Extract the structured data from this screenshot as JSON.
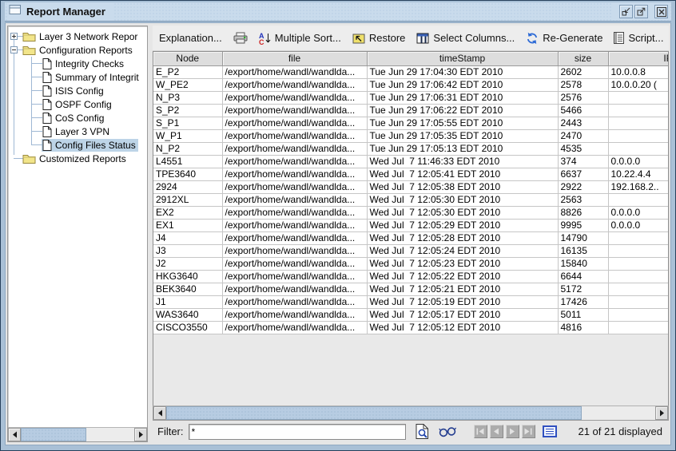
{
  "window": {
    "title": "Report Manager",
    "controls": [
      {
        "name": "minimize-button",
        "icon": "minimize"
      },
      {
        "name": "maximize-button",
        "icon": "maximize"
      },
      {
        "name": "close-button",
        "icon": "close"
      }
    ]
  },
  "colors": {
    "titlebar": "#C9DBEC",
    "frame": "#A9C0D6",
    "tree_selection": "#BDD4E7",
    "scroll_thumb": "#B7CCE2",
    "header_bg": "#DDDDDD"
  },
  "tree": {
    "items": [
      {
        "name": "tree-item-layer3-network-reports",
        "label": "Layer 3 Network Repor",
        "type": "folder",
        "level": 0,
        "handle": "+",
        "selected": false
      },
      {
        "name": "tree-item-configuration-reports",
        "label": "Configuration Reports",
        "type": "folder",
        "level": 0,
        "handle": "-",
        "selected": false
      },
      {
        "name": "tree-item-integrity-checks",
        "label": "Integrity Checks",
        "type": "doc",
        "level": 1,
        "handle": null,
        "selected": false
      },
      {
        "name": "tree-item-summary-of-integrity",
        "label": "Summary of Integrit",
        "type": "doc",
        "level": 1,
        "handle": null,
        "selected": false
      },
      {
        "name": "tree-item-isis-config",
        "label": "ISIS Config",
        "type": "doc",
        "level": 1,
        "handle": null,
        "selected": false
      },
      {
        "name": "tree-item-ospf-config",
        "label": "OSPF Config",
        "type": "doc",
        "level": 1,
        "handle": null,
        "selected": false
      },
      {
        "name": "tree-item-cos-config",
        "label": "CoS Config",
        "type": "doc",
        "level": 1,
        "handle": null,
        "selected": false
      },
      {
        "name": "tree-item-layer3-vpn",
        "label": "Layer 3 VPN",
        "type": "doc",
        "level": 1,
        "handle": null,
        "selected": false
      },
      {
        "name": "tree-item-config-files-status",
        "label": "Config Files Status",
        "type": "doc",
        "level": 1,
        "handle": null,
        "selected": true
      },
      {
        "name": "tree-item-customized-reports",
        "label": "Customized Reports",
        "type": "folder",
        "level": 0,
        "handle": null,
        "selected": false
      }
    ]
  },
  "toolbar": {
    "buttons": [
      {
        "name": "explanation-button",
        "label": "Explanation...",
        "icon": null
      },
      {
        "name": "print-button",
        "label": "",
        "icon": "printer"
      },
      {
        "name": "multiple-sort-button",
        "label": "Multiple Sort...",
        "icon": "sort"
      },
      {
        "name": "restore-button",
        "label": "Restore",
        "icon": "restore"
      },
      {
        "name": "select-columns-button",
        "label": "Select Columns...",
        "icon": "columns"
      },
      {
        "name": "regenerate-button",
        "label": "Re-Generate",
        "icon": "refresh"
      },
      {
        "name": "script-button",
        "label": "Script...",
        "icon": "script"
      },
      {
        "name": "help-button",
        "label": "",
        "icon": "help"
      }
    ]
  },
  "table": {
    "columns": [
      {
        "label": "Node"
      },
      {
        "label": "file"
      },
      {
        "label": "timeStamp"
      },
      {
        "label": "size"
      },
      {
        "label": "IP"
      }
    ],
    "rows": [
      [
        "E_P2",
        "/export/home/wandl/wandlda...",
        "Tue Jun 29 17:04:30 EDT 2010",
        "2602",
        "10.0.0.8"
      ],
      [
        "W_PE2",
        "/export/home/wandl/wandlda...",
        "Tue Jun 29 17:06:42 EDT 2010",
        "2578",
        "10.0.0.20 ("
      ],
      [
        "N_P3",
        "/export/home/wandl/wandlda...",
        "Tue Jun 29 17:06:31 EDT 2010",
        "2576",
        ""
      ],
      [
        "S_P2",
        "/export/home/wandl/wandlda...",
        "Tue Jun 29 17:06:22 EDT 2010",
        "5466",
        ""
      ],
      [
        "S_P1",
        "/export/home/wandl/wandlda...",
        "Tue Jun 29 17:05:55 EDT 2010",
        "2443",
        ""
      ],
      [
        "W_P1",
        "/export/home/wandl/wandlda...",
        "Tue Jun 29 17:05:35 EDT 2010",
        "2470",
        ""
      ],
      [
        "N_P2",
        "/export/home/wandl/wandlda...",
        "Tue Jun 29 17:05:13 EDT 2010",
        "4535",
        ""
      ],
      [
        "L4551",
        "/export/home/wandl/wandlda...",
        "Wed Jul  7 11:46:33 EDT 2010",
        "374",
        "0.0.0.0"
      ],
      [
        "TPE3640",
        "/export/home/wandl/wandlda...",
        "Wed Jul  7 12:05:41 EDT 2010",
        "6637",
        "10.22.4.4"
      ],
      [
        "2924",
        "/export/home/wandl/wandlda...",
        "Wed Jul  7 12:05:38 EDT 2010",
        "2922",
        "192.168.2.."
      ],
      [
        "2912XL",
        "/export/home/wandl/wandlda...",
        "Wed Jul  7 12:05:30 EDT 2010",
        "2563",
        ""
      ],
      [
        "EX2",
        "/export/home/wandl/wandlda...",
        "Wed Jul  7 12:05:30 EDT 2010",
        "8826",
        "0.0.0.0"
      ],
      [
        "EX1",
        "/export/home/wandl/wandlda...",
        "Wed Jul  7 12:05:29 EDT 2010",
        "9995",
        "0.0.0.0"
      ],
      [
        "J4",
        "/export/home/wandl/wandlda...",
        "Wed Jul  7 12:05:28 EDT 2010",
        "14790",
        ""
      ],
      [
        "J3",
        "/export/home/wandl/wandlda...",
        "Wed Jul  7 12:05:24 EDT 2010",
        "16135",
        ""
      ],
      [
        "J2",
        "/export/home/wandl/wandlda...",
        "Wed Jul  7 12:05:23 EDT 2010",
        "15840",
        ""
      ],
      [
        "HKG3640",
        "/export/home/wandl/wandlda...",
        "Wed Jul  7 12:05:22 EDT 2010",
        "6644",
        ""
      ],
      [
        "BEK3640",
        "/export/home/wandl/wandlda...",
        "Wed Jul  7 12:05:21 EDT 2010",
        "5172",
        ""
      ],
      [
        "J1",
        "/export/home/wandl/wandlda...",
        "Wed Jul  7 12:05:19 EDT 2010",
        "17426",
        ""
      ],
      [
        "WAS3640",
        "/export/home/wandl/wandlda...",
        "Wed Jul  7 12:05:17 EDT 2010",
        "5011",
        ""
      ],
      [
        "CISCO3550",
        "/export/home/wandl/wandlda...",
        "Wed Jul  7 12:05:12 EDT 2010",
        "4816",
        ""
      ]
    ]
  },
  "filter": {
    "label": "Filter:",
    "value": "*",
    "icons": [
      {
        "name": "filter-report-button",
        "icon": "doc-magnifier"
      },
      {
        "name": "advanced-search-button",
        "icon": "glasses"
      }
    ],
    "nav": [
      {
        "name": "first-page-button",
        "icon": "nav-first"
      },
      {
        "name": "prev-page-button",
        "icon": "nav-prev"
      },
      {
        "name": "next-page-button",
        "icon": "nav-next"
      },
      {
        "name": "last-page-button",
        "icon": "nav-last"
      }
    ],
    "status": "21 of 21 displayed"
  }
}
